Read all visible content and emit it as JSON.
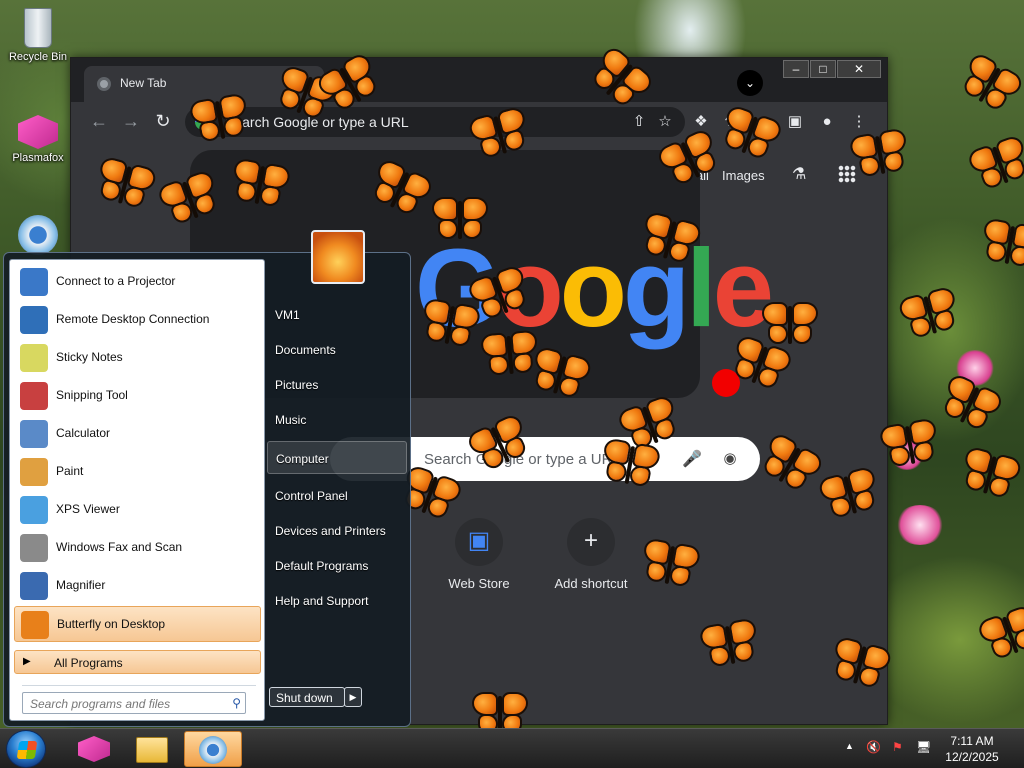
{
  "desktop": {
    "icons": [
      {
        "label": "Recycle Bin",
        "icon": "recycle-bin-icon"
      },
      {
        "label": "Plasmafox",
        "icon": "plasmafox-icon"
      },
      {
        "label": "",
        "icon": "chrome-shortcut-icon"
      }
    ]
  },
  "browser": {
    "tab_title": "New Tab",
    "tab_search_icon": "chevron-down-icon",
    "window_buttons": [
      "minimize-icon",
      "maximize-icon",
      "close-icon"
    ],
    "omnibox_placeholder": "Search Google or type a URL",
    "ntp": {
      "top_links": [
        "Gmail",
        "Images"
      ],
      "logo_text": "Google",
      "search_placeholder": "Search Google or type a URL",
      "shortcuts": [
        {
          "label": "Web Store",
          "icon": "web-store-icon"
        },
        {
          "label": "Add shortcut",
          "icon": "plus-icon"
        }
      ]
    }
  },
  "start_menu": {
    "programs": [
      {
        "label": "Connect to a Projector",
        "icon": "projector-icon",
        "color": "#3a78c8"
      },
      {
        "label": "Remote Desktop Connection",
        "icon": "remote-desktop-icon",
        "color": "#2f6fb8"
      },
      {
        "label": "Sticky Notes",
        "icon": "sticky-notes-icon",
        "color": "#d8d860"
      },
      {
        "label": "Snipping Tool",
        "icon": "snipping-tool-icon",
        "color": "#c84040"
      },
      {
        "label": "Calculator",
        "icon": "calculator-icon",
        "color": "#5a8ac8"
      },
      {
        "label": "Paint",
        "icon": "paint-icon",
        "color": "#e0a040"
      },
      {
        "label": "XPS Viewer",
        "icon": "xps-viewer-icon",
        "color": "#4aa0e0"
      },
      {
        "label": "Windows Fax and Scan",
        "icon": "fax-scan-icon",
        "color": "#8a8a8a"
      },
      {
        "label": "Magnifier",
        "icon": "magnifier-icon",
        "color": "#3a6ab0"
      },
      {
        "label": "Butterfly on Desktop",
        "icon": "butterfly-icon",
        "color": "#e8801a"
      }
    ],
    "all_programs": "All Programs",
    "search_placeholder": "Search programs and files",
    "places": [
      "VM1",
      "Documents",
      "Pictures",
      "Music",
      "Computer",
      "Control Panel",
      "Devices and Printers",
      "Default Programs",
      "Help and Support"
    ],
    "shutdown_label": "Shut down"
  },
  "taskbar": {
    "apps": [
      "plasmafox-taskbar-icon",
      "explorer-taskbar-icon",
      "chrome-taskbar-icon"
    ],
    "tray_icons": [
      "show-hidden-icons-icon",
      "volume-muted-icon",
      "action-center-icon",
      "network-icon"
    ],
    "time": "7:11 AM",
    "date": "12/2/2025"
  }
}
